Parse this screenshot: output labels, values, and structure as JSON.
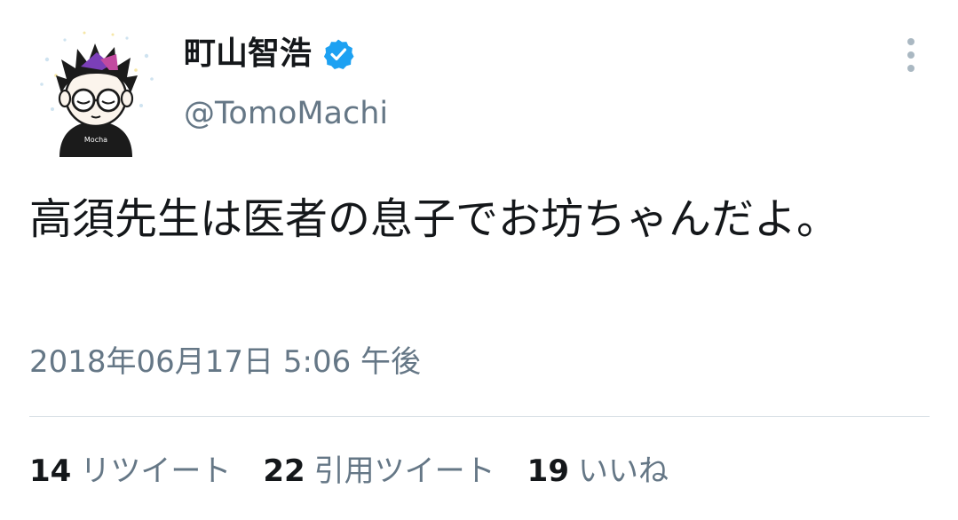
{
  "author": {
    "display_name": "町山智浩",
    "handle": "@TomoMachi",
    "verified": true,
    "avatar_icon": "cartoon-avatar-icon",
    "avatar_shirt_text": "Mocha"
  },
  "tweet": {
    "text": "高須先生は医者の息子でお坊ちゃんだよ。",
    "timestamp": "2018年06月17日 5:06 午後"
  },
  "stats": {
    "retweets": {
      "count": "14",
      "label": "リツイート"
    },
    "quote_tweets": {
      "count": "22",
      "label": "引用ツイート"
    },
    "likes": {
      "count": "19",
      "label": "いいね"
    }
  },
  "colors": {
    "text_primary": "#14171a",
    "text_secondary": "#657786",
    "verified_blue": "#1da1f2",
    "divider": "#d5dde3",
    "menu_icon": "#aab8c2"
  },
  "icons": {
    "verified": "verified-badge-icon",
    "more": "more-vertical-icon"
  }
}
